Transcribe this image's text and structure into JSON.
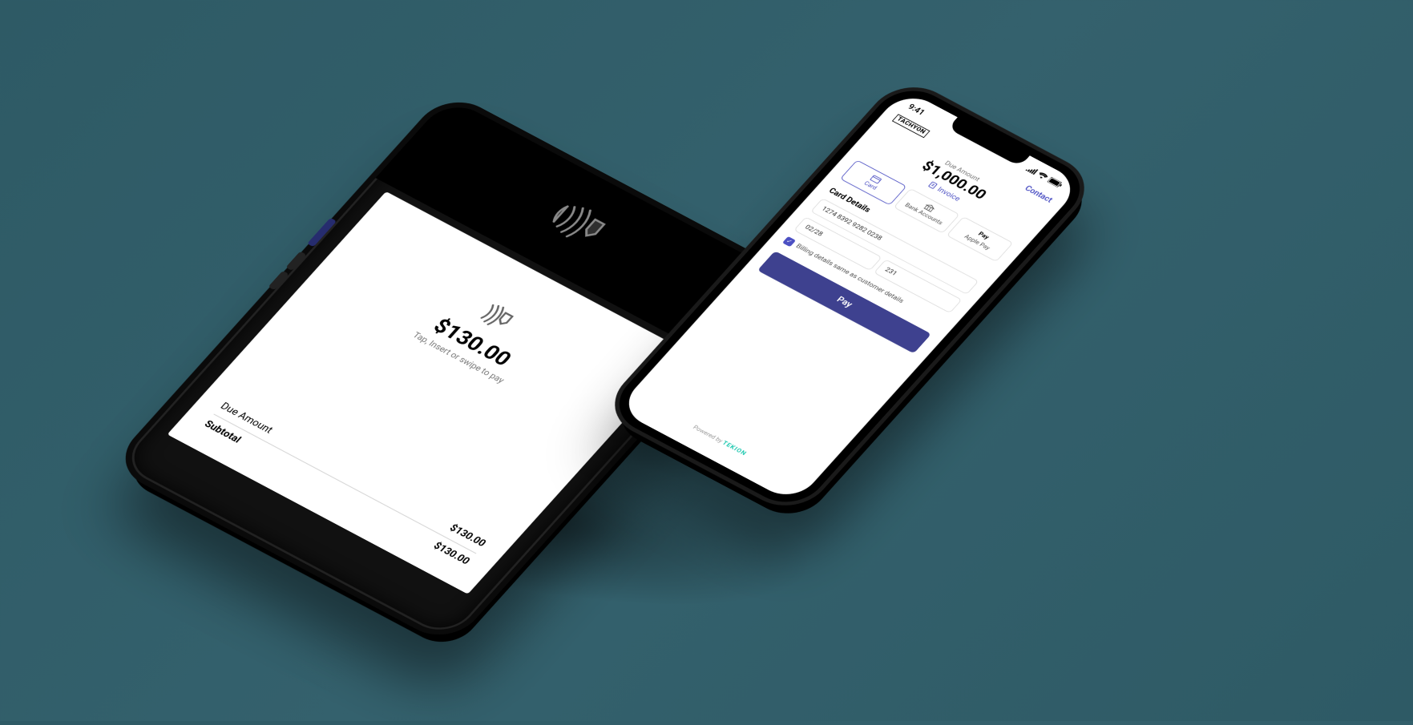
{
  "terminal": {
    "amount": "$130.00",
    "hint": "Tap, Insert or swipe to pay",
    "due_label": "Due Amount",
    "due_value": "$130.00",
    "subtotal_label": "Subtotal",
    "subtotal_value": "$130.00"
  },
  "phone": {
    "status": {
      "time": "9:41"
    },
    "logo": "TACHYON",
    "contact_label": "Contact",
    "due_label": "Due Amount",
    "due_amount": "$1,000.00",
    "invoice_label": "Invoice",
    "methods": {
      "card": "Card",
      "bank": "Bank Accounts",
      "apple": "Apple Pay",
      "apple_icon_text": "Pay"
    },
    "card_details_title": "Card Details",
    "card_number": "1274 8392 9282 0238",
    "card_exp": "02/28",
    "card_cvv": "231",
    "billing_same_label": "Billing details same as customer details",
    "pay_button": "Pay",
    "powered_prefix": "Powered by ",
    "powered_brand": "TEKION"
  },
  "colors": {
    "accent": "#4c50c3",
    "brand_teal": "#1ec8b0"
  }
}
